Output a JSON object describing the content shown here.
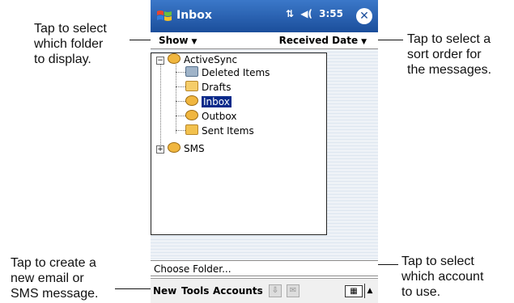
{
  "callouts": {
    "left_top": [
      "Tap to select",
      "which folder",
      "to display."
    ],
    "right_top": [
      "Tap to select a",
      "sort order for",
      "the messages."
    ],
    "left_bottom": [
      "Tap to create a",
      "new email or",
      "SMS message."
    ],
    "right_bottom": [
      "Tap to select",
      "which account",
      "to use."
    ]
  },
  "titlebar": {
    "title": "Inbox",
    "time": "3:55",
    "signal_icon": "signal-icon",
    "volume_icon": "volume-icon"
  },
  "toolbar": {
    "show_label": "Show",
    "sort_label": "Received Date"
  },
  "folders": {
    "activesync": "ActiveSync",
    "deleted": "Deleted Items",
    "drafts": "Drafts",
    "inbox": "Inbox",
    "outbox": "Outbox",
    "sent": "Sent Items",
    "sms": "SMS"
  },
  "choose_folder": "Choose Folder...",
  "menubar": {
    "new": "New",
    "tools": "Tools",
    "accounts": "Accounts"
  },
  "colors": {
    "titlebar": "#1b4e9b",
    "selection": "#0a2a8a"
  }
}
